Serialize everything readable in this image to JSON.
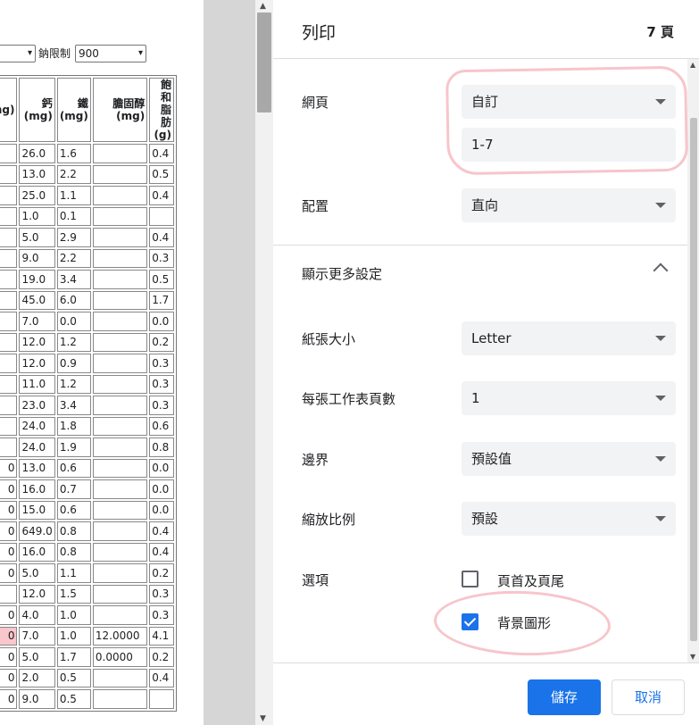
{
  "preview": {
    "filter": {
      "left_select_value": "",
      "sodium_label": "鈉限制",
      "sodium_value": "900"
    },
    "table": {
      "headers": [
        "mg)",
        "鈣\n(mg)",
        "鐵\n(mg)",
        "膽固醇\n(mg)",
        "飽和\n脂肪\n(g)"
      ],
      "rows": [
        [
          "",
          "26.0",
          "1.6",
          "",
          "0.4"
        ],
        [
          "",
          "13.0",
          "2.2",
          "",
          "0.5"
        ],
        [
          "",
          "25.0",
          "1.1",
          "",
          "0.4"
        ],
        [
          "",
          "1.0",
          "0.1",
          "",
          ""
        ],
        [
          "",
          "5.0",
          "2.9",
          "",
          "0.4"
        ],
        [
          "",
          "9.0",
          "2.2",
          "",
          "0.3"
        ],
        [
          "",
          "19.0",
          "3.4",
          "",
          "0.5"
        ],
        [
          "",
          "45.0",
          "6.0",
          "",
          "1.7"
        ],
        [
          "",
          "7.0",
          "0.0",
          "",
          "0.0"
        ],
        [
          "",
          "12.0",
          "1.2",
          "",
          "0.2"
        ],
        [
          "",
          "12.0",
          "0.9",
          "",
          "0.3"
        ],
        [
          "",
          "11.0",
          "1.2",
          "",
          "0.3"
        ],
        [
          "",
          "23.0",
          "3.4",
          "",
          "0.3"
        ],
        [
          "",
          "24.0",
          "1.8",
          "",
          "0.6"
        ],
        [
          "",
          "24.0",
          "1.9",
          "",
          "0.8"
        ],
        [
          "0",
          "13.0",
          "0.6",
          "",
          "0.0"
        ],
        [
          "0",
          "16.0",
          "0.7",
          "",
          "0.0"
        ],
        [
          "0",
          "15.0",
          "0.6",
          "",
          "0.0"
        ],
        [
          "0",
          "649.0",
          "0.8",
          "",
          "0.4"
        ],
        [
          "0",
          "16.0",
          "0.8",
          "",
          "0.4"
        ],
        [
          "0",
          "5.0",
          "1.1",
          "",
          "0.2"
        ],
        [
          "",
          "12.0",
          "1.5",
          "",
          "0.3"
        ],
        [
          "0",
          "4.0",
          "1.0",
          "",
          "0.3"
        ],
        [
          "0",
          "7.0",
          "1.0",
          "12.0000",
          "4.1"
        ],
        [
          "0",
          "5.0",
          "1.7",
          "0.0000",
          "0.2"
        ],
        [
          "0",
          "2.0",
          "0.5",
          "",
          "0.4"
        ],
        [
          "0",
          "9.0",
          "0.5",
          "",
          ""
        ]
      ],
      "highlight_row": 23
    }
  },
  "dialog": {
    "title": "列印",
    "page_count": "7 頁",
    "pages": {
      "label": "網頁",
      "value": "自訂",
      "range": "1-7"
    },
    "layout": {
      "label": "配置",
      "value": "直向"
    },
    "more_settings_label": "顯示更多設定",
    "paper_size": {
      "label": "紙張大小",
      "value": "Letter"
    },
    "pages_per_sheet": {
      "label": "每張工作表頁數",
      "value": "1"
    },
    "margins": {
      "label": "邊界",
      "value": "預設值"
    },
    "scale": {
      "label": "縮放比例",
      "value": "預設"
    },
    "options": {
      "label": "選項",
      "headers_footers": {
        "label": "頁首及頁尾",
        "checked": false
      },
      "background_graphics": {
        "label": "背景圖形",
        "checked": true
      }
    },
    "save_label": "儲存",
    "cancel_label": "取消"
  },
  "colors": {
    "primary": "#1a73e8",
    "dropdown_bg": "#f1f3f4",
    "annotation": "#f096a0",
    "row_highlight": "#f8c6cb"
  }
}
